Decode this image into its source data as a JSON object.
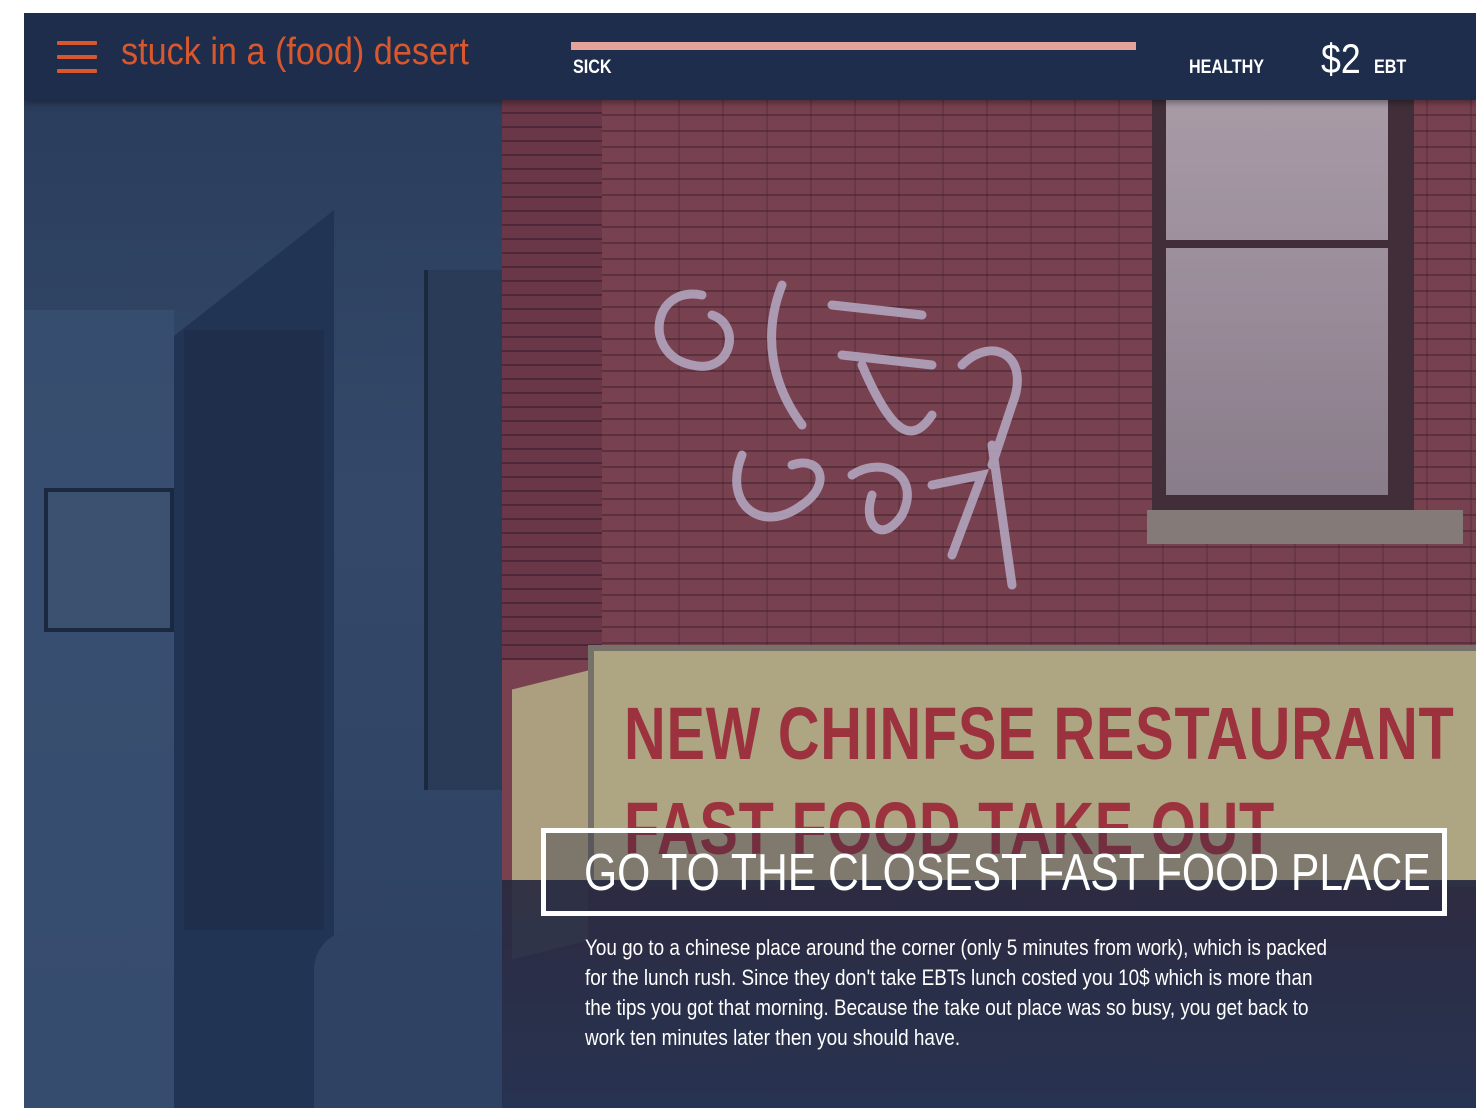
{
  "app": {
    "title": "stuck in a (food) desert"
  },
  "health_meter": {
    "left_label": "SICK",
    "right_label": "HEALTHY",
    "level": 1.0,
    "fill_color": "#e3a29a"
  },
  "wallet": {
    "amount": "$2",
    "unit": "EBT"
  },
  "scene": {
    "sign_line_1": "NEW CHINFSE RESTAURANT",
    "sign_line_2": "FAST FOOD  TAKE OUT"
  },
  "choice": {
    "title": "GO TO THE CLOSEST FAST FOOD PLACE"
  },
  "narrative": {
    "lines": [
      "You go to a chinese place around the corner (only 5 minutes from work), which is packed",
      "for the lunch rush. Since they don't take EBTs lunch costed you 10$ which is more than",
      "the tips you got that morning. Because the take out place was so busy, you get back to",
      "work ten minutes later then you should have."
    ]
  },
  "colors": {
    "accent": "#d9572d",
    "header_bg": "#1d2d4b",
    "panel_bg": "#2c3e5e"
  },
  "icons": {
    "menu": "hamburger-menu-icon"
  }
}
